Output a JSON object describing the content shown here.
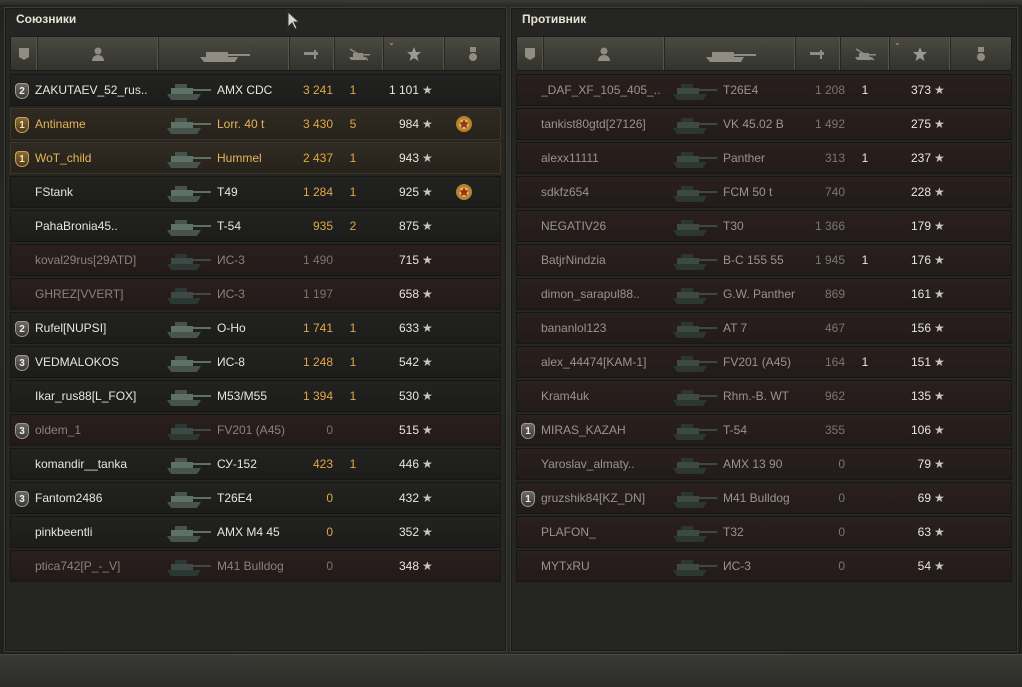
{
  "allies": {
    "title": "Союзники",
    "rows": [
      {
        "badge": "2",
        "name": "ZAKUTAEV_52_rus..",
        "vehicle": "AMX CDC",
        "damage": "3 241",
        "frags": "1",
        "xp": "1 101",
        "medal": false,
        "state": "alive"
      },
      {
        "badge": "1",
        "name": "Antiname",
        "vehicle": "Lorr. 40 t",
        "damage": "3 430",
        "frags": "5",
        "xp": "984",
        "medal": true,
        "state": "platoon"
      },
      {
        "badge": "1",
        "name": "WoT_child",
        "vehicle": "Hummel",
        "damage": "2 437",
        "frags": "1",
        "xp": "943",
        "medal": false,
        "state": "platoon"
      },
      {
        "badge": "",
        "name": "FStank",
        "vehicle": "T49",
        "damage": "1 284",
        "frags": "1",
        "xp": "925",
        "medal": true,
        "state": "alive"
      },
      {
        "badge": "",
        "name": "PahaBronia45..",
        "vehicle": "T-54",
        "damage": "935",
        "frags": "2",
        "xp": "875",
        "medal": false,
        "state": "alive"
      },
      {
        "badge": "",
        "name": "koval29rus[29ATD]",
        "vehicle": "ИС-3",
        "damage": "1 490",
        "frags": "",
        "xp": "715",
        "medal": false,
        "state": "dead"
      },
      {
        "badge": "",
        "name": "GHREZ[VVERT]",
        "vehicle": "ИС-3",
        "damage": "1 197",
        "frags": "",
        "xp": "658",
        "medal": false,
        "state": "dead"
      },
      {
        "badge": "2",
        "name": "Rufel[NUPSI]",
        "vehicle": "O-Ho",
        "damage": "1 741",
        "frags": "1",
        "xp": "633",
        "medal": false,
        "state": "alive"
      },
      {
        "badge": "3",
        "name": "VEDMALOKOS",
        "vehicle": "ИС-8",
        "damage": "1 248",
        "frags": "1",
        "xp": "542",
        "medal": false,
        "state": "alive"
      },
      {
        "badge": "",
        "name": "Ikar_rus88[L_FOX]",
        "vehicle": "M53/M55",
        "damage": "1 394",
        "frags": "1",
        "xp": "530",
        "medal": false,
        "state": "alive"
      },
      {
        "badge": "3",
        "name": "oldem_1",
        "vehicle": "FV201 (A45)",
        "damage": "0",
        "frags": "",
        "xp": "515",
        "medal": false,
        "state": "dead"
      },
      {
        "badge": "",
        "name": "komandir__tanka",
        "vehicle": "СУ-152",
        "damage": "423",
        "frags": "1",
        "xp": "446",
        "medal": false,
        "state": "alive"
      },
      {
        "badge": "3",
        "name": "Fantom2486",
        "vehicle": "T26E4",
        "damage": "0",
        "frags": "",
        "xp": "432",
        "medal": false,
        "state": "alive"
      },
      {
        "badge": "",
        "name": "pinkbeentli",
        "vehicle": "AMX M4 45",
        "damage": "0",
        "frags": "",
        "xp": "352",
        "medal": false,
        "state": "alive"
      },
      {
        "badge": "",
        "name": "ptica742[P_-_V]",
        "vehicle": "M41 Bulldog",
        "damage": "0",
        "frags": "",
        "xp": "348",
        "medal": false,
        "state": "dead"
      }
    ]
  },
  "enemies": {
    "title": "Противник",
    "rows": [
      {
        "badge": "",
        "name": "_DAF_XF_105_405_..",
        "vehicle": "T26E4",
        "damage": "1 208",
        "frags": "1",
        "xp": "373"
      },
      {
        "badge": "",
        "name": "tankist80gtd[27126]",
        "vehicle": "VK 45.02 B",
        "damage": "1 492",
        "frags": "",
        "xp": "275"
      },
      {
        "badge": "",
        "name": "alexx11111",
        "vehicle": "Panther",
        "damage": "313",
        "frags": "1",
        "xp": "237"
      },
      {
        "badge": "",
        "name": "sdkfz654",
        "vehicle": "FCM 50 t",
        "damage": "740",
        "frags": "",
        "xp": "228"
      },
      {
        "badge": "",
        "name": "NEGATIV26",
        "vehicle": "T30",
        "damage": "1 366",
        "frags": "",
        "xp": "179"
      },
      {
        "badge": "",
        "name": "BatjrNindzia",
        "vehicle": "B-C 155 55",
        "damage": "1 945",
        "frags": "1",
        "xp": "176"
      },
      {
        "badge": "",
        "name": "dimon_sarapul88..",
        "vehicle": "G.W. Panther",
        "damage": "869",
        "frags": "",
        "xp": "161"
      },
      {
        "badge": "",
        "name": "bananlol123",
        "vehicle": "AT 7",
        "damage": "467",
        "frags": "",
        "xp": "156"
      },
      {
        "badge": "",
        "name": "alex_44474[KAM-1]",
        "vehicle": "FV201 (A45)",
        "damage": "164",
        "frags": "1",
        "xp": "151"
      },
      {
        "badge": "",
        "name": "Kram4uk",
        "vehicle": "Rhm.-B. WT",
        "damage": "962",
        "frags": "",
        "xp": "135"
      },
      {
        "badge": "1",
        "name": "MIRAS_KAZAH",
        "vehicle": "T-54",
        "damage": "355",
        "frags": "",
        "xp": "106"
      },
      {
        "badge": "",
        "name": "Yaroslav_almaty..",
        "vehicle": "AMX 13 90",
        "damage": "0",
        "frags": "",
        "xp": "79"
      },
      {
        "badge": "1",
        "name": "gruzshik84[KZ_DN]",
        "vehicle": "M41 Bulldog",
        "damage": "0",
        "frags": "",
        "xp": "69"
      },
      {
        "badge": "",
        "name": "PLAFON_",
        "vehicle": "T32",
        "damage": "0",
        "frags": "",
        "xp": "63"
      },
      {
        "badge": "",
        "name": "MYTxRU",
        "vehicle": "ИС-3",
        "damage": "0",
        "frags": "",
        "xp": "54"
      }
    ]
  },
  "icons": {
    "star": "★",
    "sort_caret": "⌄"
  },
  "colors": {
    "gold_text": "#e1a844",
    "platoon_text": "#e6b45a",
    "dead_text": "#8a837b"
  }
}
